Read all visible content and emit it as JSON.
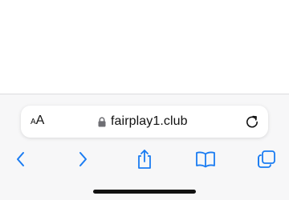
{
  "colors": {
    "accent": "#1a7cf2",
    "toolbar_bg": "#f7f7f8",
    "text": "#111111"
  },
  "address_bar": {
    "text_size_small": "A",
    "text_size_large": "A",
    "url": "fairplay1.club",
    "lock_icon": "lock-icon",
    "reload_icon": "reload-icon"
  },
  "toolbar": {
    "items": [
      {
        "name": "back",
        "icon": "chevron-left-icon"
      },
      {
        "name": "forward",
        "icon": "chevron-right-icon"
      },
      {
        "name": "share",
        "icon": "share-icon"
      },
      {
        "name": "bookmarks",
        "icon": "book-icon"
      },
      {
        "name": "tabs",
        "icon": "tabs-icon"
      }
    ]
  }
}
